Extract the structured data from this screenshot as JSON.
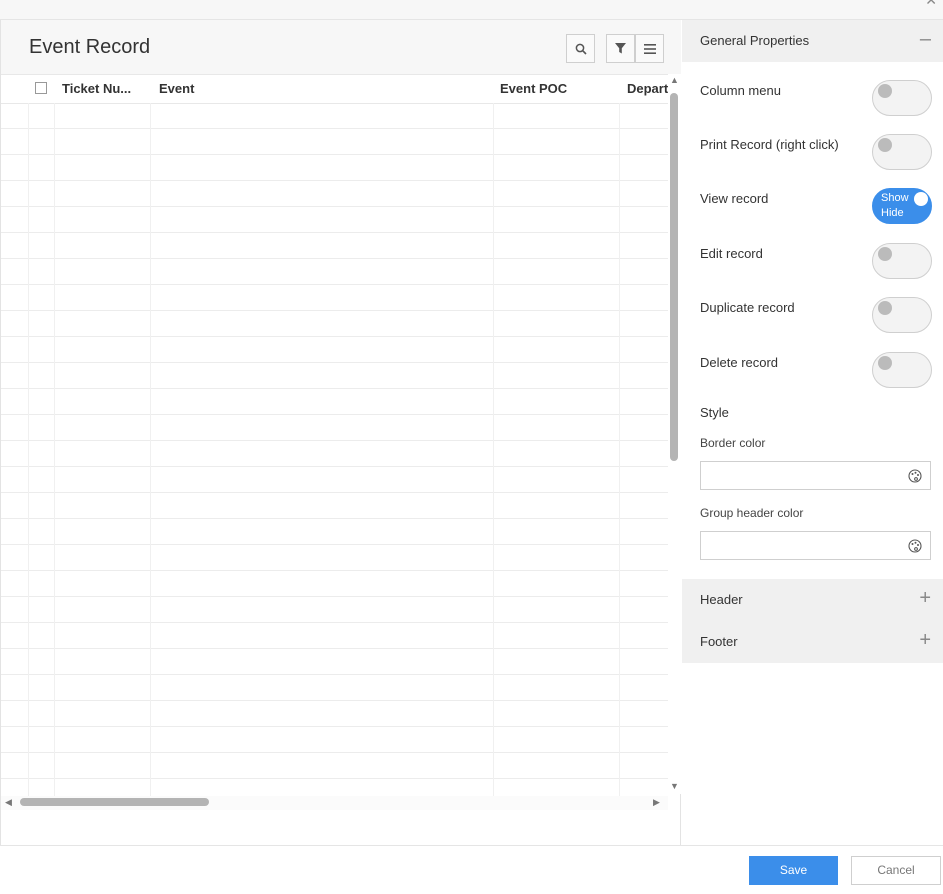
{
  "dialog": {
    "close_icon": "close-icon"
  },
  "grid": {
    "title": "Event Record",
    "columns": [
      "Ticket Nu...",
      "Event",
      "Event POC",
      "Depart"
    ],
    "row_count": 26
  },
  "panel": {
    "general_title": "General Properties",
    "general_sign": "–",
    "props": [
      {
        "label": "Column menu",
        "on": false
      },
      {
        "label": "Print Record (right click)",
        "on": false
      },
      {
        "label": "View record",
        "on": true,
        "on_text_1": "Show",
        "on_text_2": "Hide"
      },
      {
        "label": "Edit record",
        "on": false
      },
      {
        "label": "Duplicate record",
        "on": false
      },
      {
        "label": "Delete record",
        "on": false
      }
    ],
    "style_title": "Style",
    "border_color_label": "Border color",
    "group_header_color_label": "Group header color",
    "header_title": "Header",
    "footer_title": "Footer",
    "plus_sign": "+"
  },
  "footer": {
    "save_label": "Save",
    "cancel_label": "Cancel"
  },
  "colors": {
    "accent": "#3b8eea"
  }
}
